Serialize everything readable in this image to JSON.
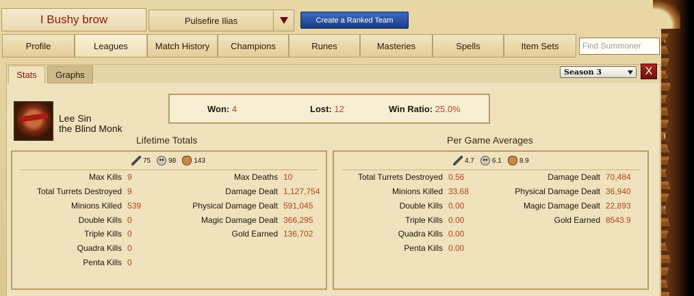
{
  "header": {
    "summoner_name": "I Bushy brow",
    "profile_select": "Pulsefire Ilias",
    "ranked_button": "Create a Ranked Team"
  },
  "nav": {
    "tabs": [
      "Profile",
      "Leagues",
      "Match History",
      "Champions",
      "Runes",
      "Masteries",
      "Spells",
      "Item Sets"
    ],
    "active_tab": "Leagues",
    "search_placeholder": "Find Summoner"
  },
  "subtabs": {
    "stats": "Stats",
    "graphs": "Graphs",
    "active": "Stats"
  },
  "season": {
    "selected": "Season 3"
  },
  "close_label": "X",
  "champion": {
    "name": "Lee Sin",
    "title": "the Blind Monk"
  },
  "record": {
    "won_label": "Won",
    "won": "4",
    "lost_label": "Lost",
    "lost": "12",
    "ratio_label": "Win Ratio",
    "ratio": "25.0%"
  },
  "lifetime": {
    "title": "Lifetime Totals",
    "kills": "75",
    "deaths": "98",
    "assists": "143",
    "left": [
      {
        "label": "Max Kills",
        "value": "9"
      },
      {
        "label": "Total Turrets Destroyed",
        "value": "9"
      },
      {
        "label": "Minions Killed",
        "value": "539"
      },
      {
        "label": "Double Kills",
        "value": "0"
      },
      {
        "label": "Triple Kills",
        "value": "0"
      },
      {
        "label": "Quadra Kills",
        "value": "0"
      },
      {
        "label": "Penta Kills",
        "value": "0"
      }
    ],
    "right": [
      {
        "label": "Max Deaths",
        "value": "10"
      },
      {
        "label": "Damage Dealt",
        "value": "1,127,754"
      },
      {
        "label": "Physical Damage Dealt",
        "value": "591,045"
      },
      {
        "label": "Magic Damage Dealt",
        "value": "366,295"
      },
      {
        "label": "Gold Earned",
        "value": "136,702"
      }
    ]
  },
  "averages": {
    "title": "Per Game Averages",
    "kills": "4.7",
    "deaths": "6.1",
    "assists": "8.9",
    "left": [
      {
        "label": "Total Turrets Destroyed",
        "value": "0.56"
      },
      {
        "label": "Minions Killed",
        "value": "33.68"
      },
      {
        "label": "Double Kills",
        "value": "0.00"
      },
      {
        "label": "Triple Kills",
        "value": "0.00"
      },
      {
        "label": "Quadra Kills",
        "value": "0.00"
      },
      {
        "label": "Penta Kills",
        "value": "0.00"
      }
    ],
    "right": [
      {
        "label": "Damage Dealt",
        "value": "70,484"
      },
      {
        "label": "Physical Damage Dealt",
        "value": "36,940"
      },
      {
        "label": "Magic Damage Dealt",
        "value": "22,893"
      },
      {
        "label": "Gold Earned",
        "value": "8543.9"
      }
    ]
  },
  "icons": {
    "kills": "sword-icon",
    "deaths": "skull-icon",
    "assists": "hand-icon",
    "close": "close-icon",
    "dropdown": "chevron-down-icon"
  },
  "colors": {
    "accent_red": "#8a1a08",
    "value_orange": "#b5451b",
    "button_blue": "#1b3d86"
  }
}
